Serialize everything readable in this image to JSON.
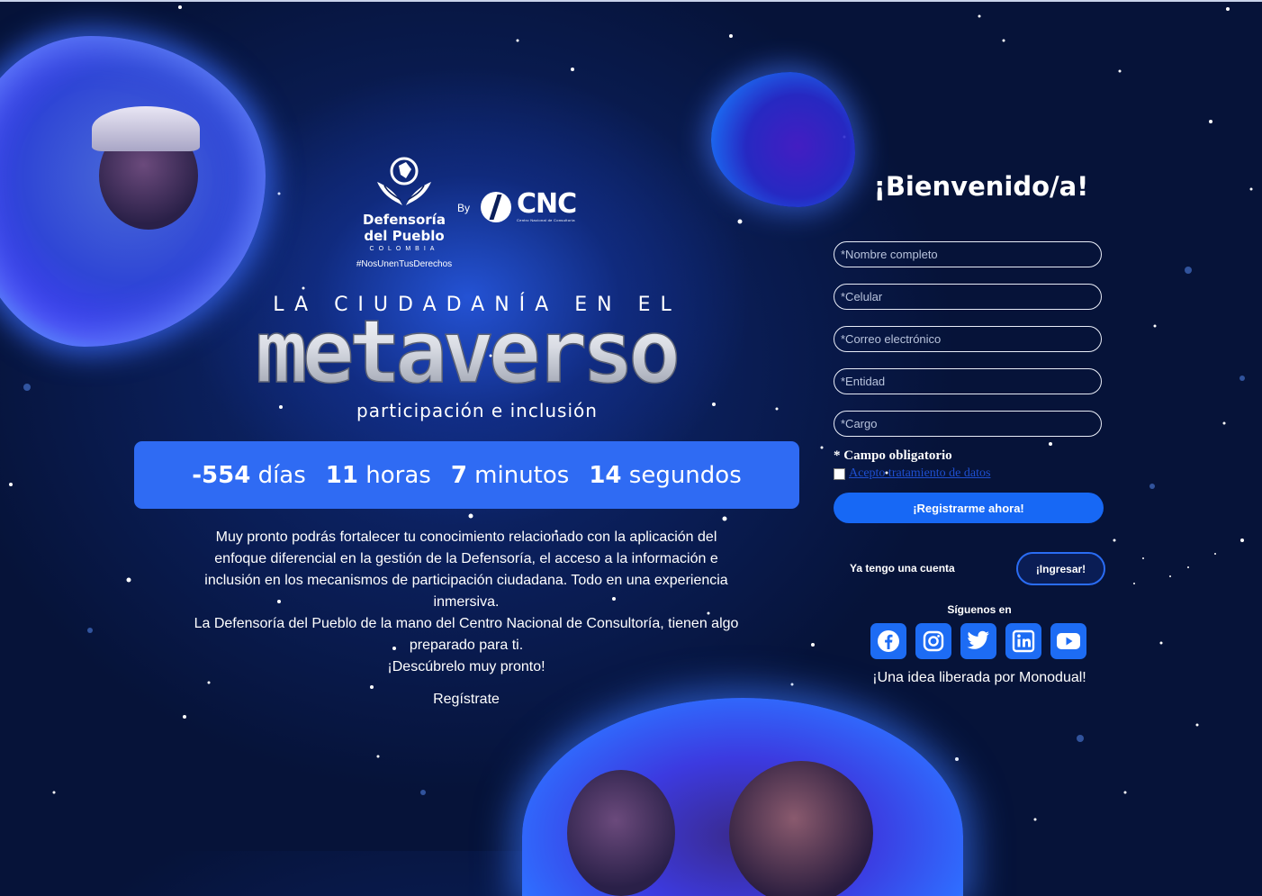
{
  "brand": {
    "defensoria_line1": "Defensoría",
    "defensoria_line2": "del Pueblo",
    "defensoria_country": "COLOMBIA",
    "hashtag": "#NosUnenTusDerechos",
    "by": "By",
    "cnc_name": "CNC",
    "cnc_sub": "Centro Nacional de Consultoría"
  },
  "hero": {
    "headline": "LA CIUDADANÍA EN EL",
    "title": "metaverso",
    "tagline": "participación e inclusión"
  },
  "countdown": {
    "days": "-554",
    "days_label": "días",
    "hours": "11",
    "hours_label": "horas",
    "minutes": "7",
    "minutes_label": "minutos",
    "seconds": "14",
    "seconds_label": "segundos"
  },
  "description": {
    "line1": "Muy pronto podrás fortalecer tu conocimiento relacionado con la aplicación del",
    "line2": "enfoque diferencial en la gestión de la Defensoría, el acceso a la información e",
    "line3": "inclusión en los mecanismos de participación ciudadana.  Todo en una experiencia",
    "line4": "inmersiva.",
    "line5": "La Defensoría del Pueblo de la mano del Centro Nacional de Consultoría, tienen algo",
    "line6": "preparado para ti.",
    "line7": "¡Descúbrelo muy pronto!",
    "register_link": "Regístrate"
  },
  "form": {
    "welcome": "¡Bienvenido/a!",
    "name_placeholder": "*Nombre completo",
    "phone_placeholder": "*Celular",
    "email_placeholder": "*Correo electrónico",
    "entity_placeholder": "*Entidad",
    "role_placeholder": "*Cargo",
    "required_note": "* Campo obligatorio",
    "terms_link": "Acepto tratamiento de datos",
    "terms_checked": false,
    "register_button": "¡Registrarme ahora!",
    "have_account": "Ya tengo una cuenta",
    "login_button": "¡Ingresar!",
    "follow_label": "Síguenos en",
    "credit": "¡Una idea liberada por Monodual!"
  },
  "socials": [
    {
      "name": "facebook-icon"
    },
    {
      "name": "instagram-icon"
    },
    {
      "name": "twitter-icon"
    },
    {
      "name": "linkedin-icon"
    },
    {
      "name": "youtube-icon"
    }
  ],
  "colors": {
    "background": "#061339",
    "accent_blue": "#2f6bf3",
    "button_blue": "#1768f5"
  }
}
